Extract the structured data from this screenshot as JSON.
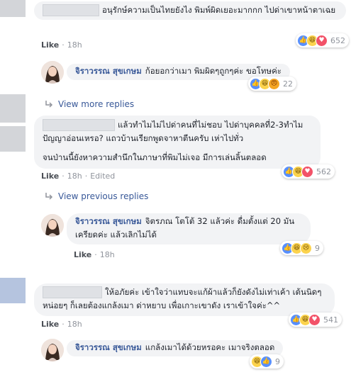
{
  "comments": [
    {
      "text": "อนุรักษ์ความเป็นไทยยังไง พิมพ์ผิดเยอะมากกก ไปด่าเขาหน้าตาเฉย",
      "like": "Like",
      "time": "18h",
      "reactions_count": "652",
      "reactions": [
        "like-icon",
        "haha-icon",
        "love-icon"
      ]
    },
    {
      "text_part1": "แล้วทำไมไม่ไปด่าคนที่ไม่ชอบ ไปด่าบุคคลที่2-3ทำไม ปัญญาอ่อนเหรอ? แถวบ้านเรียกพูดจาหาตีนครับ เห่าไปทั่ว",
      "text_part2": "จนป่านนี้ยังหาความสำนึกในภาษาที่พิมไม่เจอ มีการเล่นลิ้นตลอด",
      "like": "Like",
      "time": "18h",
      "edited": "Edited",
      "reactions_count": "562",
      "reactions": [
        "like-icon",
        "haha-icon",
        "love-icon"
      ]
    },
    {
      "text": "ให้อภัยค่ะ เข้าใจว่าแทบจะแก้ผ้าแล้วก็ยังดังไม่เท่าเค้า เต้นนิดๆหน่อยๆ ก็เลยต้องแกล้งเมา ด่าหยาบ เพื่อเกาะเขาดัง เราเข้าใจค่ะ^^",
      "like": "Like",
      "time": "18h",
      "reactions_count": "541",
      "reactions": [
        "like-icon",
        "haha-icon",
        "love-icon"
      ]
    }
  ],
  "replies": [
    {
      "name": "จิราวรรณ สุขเกษม",
      "text": "ก้อยอกว่าเมา พิมผิดๆถูกๆค่ะ ขอโทษค่ะ",
      "like": "Like",
      "time": "18h",
      "reactions_count": "22",
      "reactions": [
        "like-icon",
        "haha-icon",
        "angry-icon"
      ]
    },
    {
      "name": "จิราวรรณ สุขเกษม",
      "text": "จิตรภณ โตโต้ 32 แล้วค่ะ ดื่มตั้งแต่ 20 มัน เครียดค่ะ แล้วเลิกไม่ได้",
      "like": "Like",
      "time": "18h",
      "reactions_count": "9",
      "reactions": [
        "like-icon",
        "haha-icon",
        "sad-icon"
      ]
    },
    {
      "name": "จิราวรรณ สุขเกษม",
      "text": "แกล้งเมาได้ด้วยหรอคะ เมาจริงตลอด",
      "like": "Like",
      "time": "18h",
      "reactions_count": "9",
      "reactions": [
        "haha-icon",
        "like-icon"
      ]
    }
  ],
  "links": {
    "view_more_replies": "View more replies",
    "view_previous_replies": "View previous replies"
  },
  "colors": {
    "link": "#385898",
    "bubble": "#f2f3f5",
    "meta": "#90949c"
  }
}
